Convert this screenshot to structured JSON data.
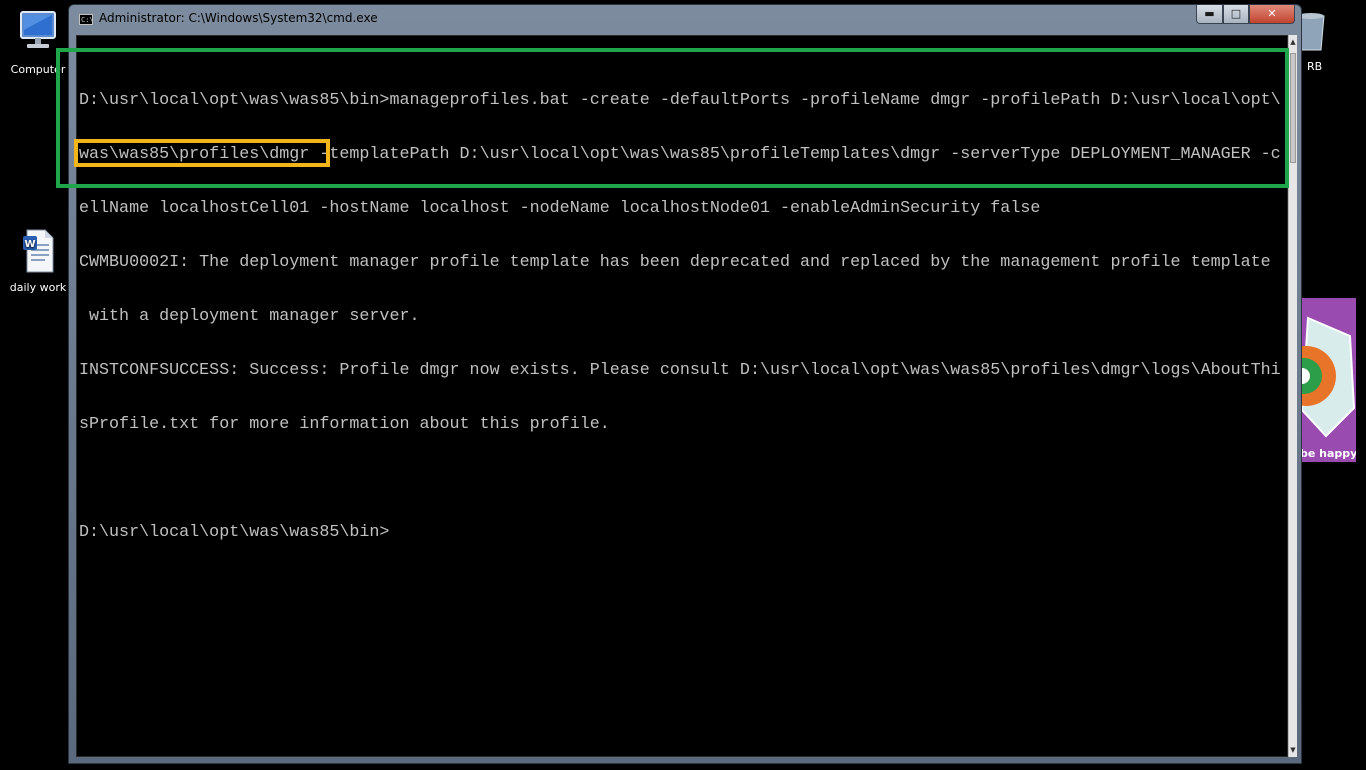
{
  "desktop": {
    "icons": [
      {
        "label": "Computer",
        "icon": "computer-icon"
      },
      {
        "label": "daily work",
        "icon": "word-document-icon"
      },
      {
        "label": "RB",
        "icon": "recycle-bin-icon"
      }
    ],
    "wallpaper_label": "be happy"
  },
  "window": {
    "title": "Administrator: C:\\Windows\\System32\\cmd.exe",
    "icon": "cmd-icon",
    "controls": {
      "minimize": "▬",
      "maximize": "□",
      "close": "✕"
    }
  },
  "console": {
    "lines": [
      "D:\\usr\\local\\opt\\was\\was85\\bin>manageprofiles.bat -create -defaultPorts -profileName dmgr -profilePath D:\\usr\\local\\opt\\",
      "was\\was85\\profiles\\dmgr -templatePath D:\\usr\\local\\opt\\was\\was85\\profileTemplates\\dmgr -serverType DEPLOYMENT_MANAGER -c",
      "ellName localhostCell01 -hostName localhost -nodeName localhostNode01 -enableAdminSecurity false",
      "CWMBU0002I: The deployment manager profile template has been deprecated and replaced by the management profile template",
      " with a deployment manager server.",
      "INSTCONFSUCCESS: Success: Profile dmgr now exists. Please consult D:\\usr\\local\\opt\\was\\was85\\profiles\\dmgr\\logs\\AboutThi",
      "sProfile.txt for more information about this profile.",
      "",
      "D:\\usr\\local\\opt\\was\\was85\\bin>"
    ]
  },
  "annotations": {
    "green_color": "#1fa54a",
    "orange_color": "#f2b61b"
  },
  "colors": {
    "console_background": "#000000",
    "console_text": "#c0c0c0"
  }
}
